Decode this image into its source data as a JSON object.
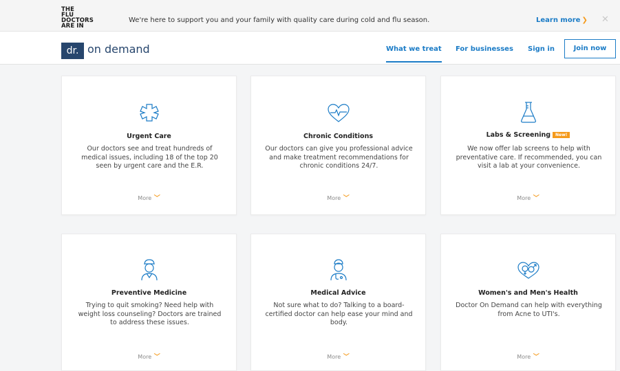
{
  "banner": {
    "logo_lines": [
      "THE",
      "FLU",
      "DOCTORS",
      "ARE IN"
    ],
    "message": "We're here to support you and your family with quality care during cold and flu season.",
    "learn_more": "Learn more",
    "close": "✕"
  },
  "header": {
    "logo_mark": "dr.",
    "logo_text": "on demand",
    "nav": {
      "what_we_treat": "What we treat",
      "for_businesses": "For businesses",
      "sign_in": "Sign in",
      "join_now": "Join now"
    }
  },
  "cards": [
    {
      "title": "Urgent Care",
      "badge": "",
      "desc": "Our doctors see and treat hundreds of medical issues, including 18 of the top 20 seen by urgent care and the E.R.",
      "more": "More",
      "icon": "medical-cross-icon"
    },
    {
      "title": "Chronic Conditions",
      "badge": "",
      "desc": "Our doctors can give you professional advice and make treatment recommendations for chronic conditions 24/7.",
      "more": "More",
      "icon": "heart-pulse-icon"
    },
    {
      "title": "Labs & Screening",
      "badge": "New!",
      "desc": "We now offer lab screens to help with preventative care. If recommended, you can visit a lab at your convenience.",
      "more": "More",
      "icon": "flask-icon"
    },
    {
      "title": "Preventive Medicine",
      "badge": "",
      "desc": "Trying to quit smoking? Need help with weight loss counseling? Doctors are trained to address these issues.",
      "more": "More",
      "icon": "nurse-icon"
    },
    {
      "title": "Medical Advice",
      "badge": "",
      "desc": "Not sure what to do? Talking to a board-certified doctor can help ease your mind and body.",
      "more": "More",
      "icon": "doctor-icon"
    },
    {
      "title": "Women's and Men's Health",
      "badge": "",
      "desc": "Doctor On Demand can help with everything from Acne to UTI's.",
      "more": "More",
      "icon": "gender-symbols-icon"
    }
  ],
  "colors": {
    "accent": "#1a7bc6",
    "brand": "#27466d",
    "highlight": "#f59a1b"
  }
}
